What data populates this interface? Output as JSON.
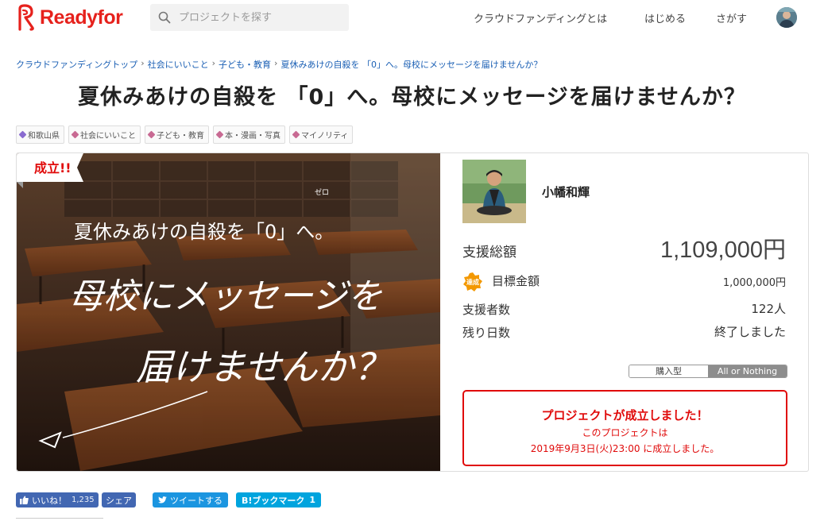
{
  "header": {
    "logo_text": "Readyfor",
    "search_placeholder": "プロジェクトを探す",
    "nav": [
      "クラウドファンディングとは",
      "はじめる",
      "さがす"
    ]
  },
  "breadcrumb": [
    "クラウドファンディングトップ",
    "社会にいいこと",
    "子ども・教育",
    "夏休みあけの自殺を 「0」へ。母校にメッセージを届けませんか？"
  ],
  "project": {
    "title": "夏休みあけの自殺を 「0」へ。母校にメッセージを届けませんか？",
    "tags": [
      "和歌山県",
      "社会にいいこと",
      "子ども・教育",
      "本・漫画・写真",
      "マイノリティ"
    ],
    "hero": {
      "badge": "成立!!",
      "line1": "夏休みあけの自殺を「0」へ。",
      "ruby": "ゼロ",
      "line2": "母校にメッセージを",
      "line3": "届けませんか？"
    },
    "owner_name": "小幡和輝",
    "stats": {
      "total_label": "支援総額",
      "total_value": "1,109,000円",
      "goal_label": "目標金額",
      "goal_value": "1,000,000円",
      "goal_badge": "達成",
      "backers_label": "支援者数",
      "backers_value": "122人",
      "days_label": "残り日数",
      "days_value": "終了しました"
    },
    "funding_type": {
      "options": [
        "購入型",
        "All or Nothing"
      ],
      "selected": "All or Nothing"
    },
    "success": {
      "title": "プロジェクトが成立しました！",
      "sub": "このプロジェクトは",
      "date": "2019年9月3日(火)23:00 に成立しました。"
    }
  },
  "social": {
    "fb_like": "いいね！",
    "fb_count": "1,235",
    "fb_share": "シェア",
    "tweet": "ツイートする",
    "hatena": "B!ブックマーク",
    "hatena_count": "1"
  },
  "colors": {
    "brand": "#e6211c",
    "success": "#e00a0a",
    "link": "#1a5fb4",
    "facebook": "#4267b2",
    "twitter": "#1b95e0",
    "hatena": "#00a4de"
  }
}
